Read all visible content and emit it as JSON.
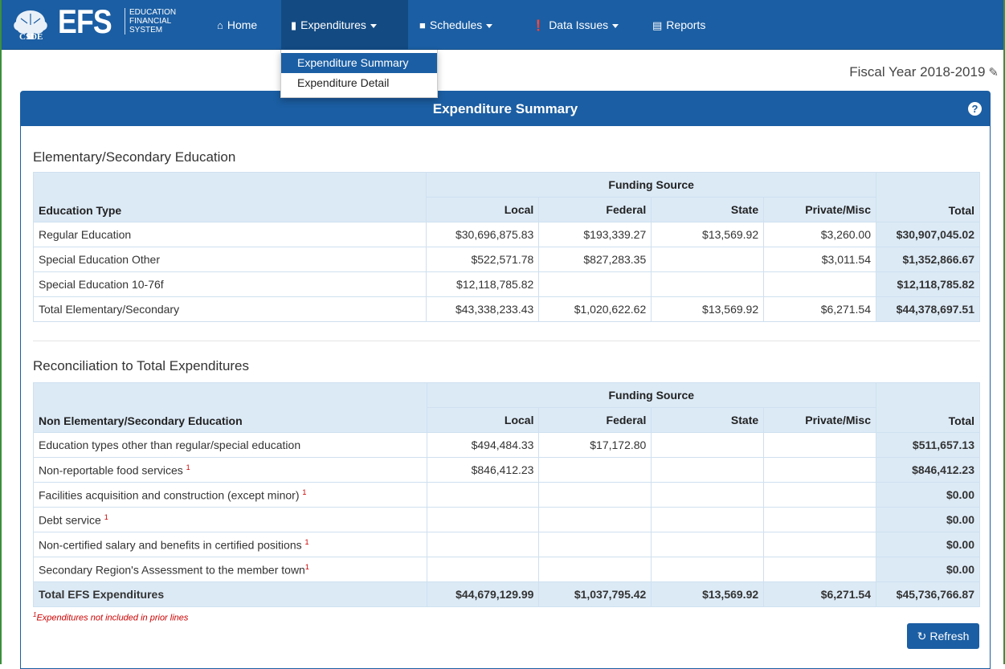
{
  "brand": {
    "logo_text": "EFS",
    "seal_text": "CSDE",
    "subtitle_lines": [
      "Education",
      "Financial",
      "System"
    ]
  },
  "nav": {
    "home": "Home",
    "expenditures": "Expenditures",
    "schedules": "Schedules",
    "data_issues": "Data Issues",
    "reports": "Reports"
  },
  "dropdown": {
    "items": [
      "Expenditure Summary",
      "Expenditure Detail"
    ],
    "selected": "Expenditure Summary"
  },
  "fiscal_year": "Fiscal Year 2018-2019",
  "panel_title": "Expenditure Summary",
  "section1": {
    "title": "Elementary/Secondary Education",
    "group_header": "Funding Source",
    "columns": [
      "Education Type",
      "Local",
      "Federal",
      "State",
      "Private/Misc",
      "Total"
    ],
    "rows": [
      [
        "Regular Education",
        "$30,696,875.83",
        "$193,339.27",
        "$13,569.92",
        "$3,260.00",
        "$30,907,045.02"
      ],
      [
        "Special Education Other",
        "$522,571.78",
        "$827,283.35",
        "",
        "$3,011.54",
        "$1,352,866.67"
      ],
      [
        "Special Education 10-76f",
        "$12,118,785.82",
        "",
        "",
        "",
        "$12,118,785.82"
      ],
      [
        "Total Elementary/Secondary",
        "$43,338,233.43",
        "$1,020,622.62",
        "$13,569.92",
        "$6,271.54",
        "$44,378,697.51"
      ]
    ]
  },
  "section2": {
    "title": "Reconciliation to Total Expenditures",
    "group_header": "Funding Source",
    "columns": [
      "Non Elementary/Secondary Education",
      "Local",
      "Federal",
      "State",
      "Private/Misc",
      "Total"
    ],
    "rows": [
      [
        "Education types other than regular/special education",
        "$494,484.33",
        "$17,172.80",
        "",
        "",
        "$511,657.13"
      ],
      [
        "Non-reportable food services",
        "$846,412.23",
        "",
        "",
        "",
        "$846,412.23"
      ],
      [
        "Facilities acquisition and construction (except minor)",
        "",
        "",
        "",
        "",
        "$0.00"
      ],
      [
        "Debt service",
        "",
        "",
        "",
        "",
        "$0.00"
      ],
      [
        "Non-certified salary and benefits in certified positions",
        "",
        "",
        "",
        "",
        "$0.00"
      ],
      [
        "Secondary Region's Assessment to the member town",
        "",
        "",
        "",
        "",
        "$0.00"
      ]
    ],
    "footnoted_rows": [
      1,
      2,
      3,
      4,
      5
    ],
    "total_row": [
      "Total EFS Expenditures",
      "$44,679,129.99",
      "$1,037,795.42",
      "$13,569.92",
      "$6,271.54",
      "$45,736,766.87"
    ]
  },
  "footnote_marker": "1",
  "footnote": "Expenditures not included in prior lines",
  "refresh_label": "Refresh",
  "colors": {
    "primary": "#1b5ea3",
    "header_fill": "#dceaf6",
    "footnote": "#cc0000"
  }
}
